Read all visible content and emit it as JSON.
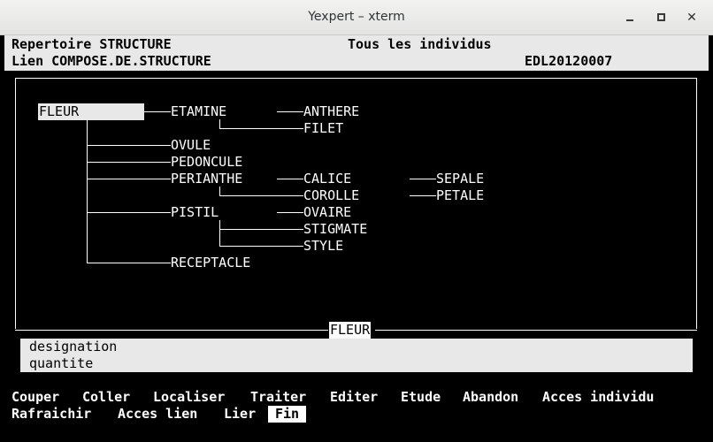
{
  "window": {
    "title": "Yexpert – xterm"
  },
  "header": {
    "repertoire": "Repertoire STRUCTURE",
    "scope": "Tous les individus",
    "lien": "Lien COMPOSE.DE.STRUCTURE",
    "code": "EDL20120007"
  },
  "tree": {
    "root": "FLEUR",
    "nodes": {
      "etamine": "ETAMINE",
      "anthere": "ANTHERE",
      "filet": "FILET",
      "ovule": "OVULE",
      "pedoncule": "PEDONCULE",
      "perianthe": "PERIANTHE",
      "calice": "CALICE",
      "sepale": "SEPALE",
      "corolle": "COROLLE",
      "petale": "PETALE",
      "pistil": "PISTIL",
      "ovaire": "OVAIRE",
      "stigmate": "STIGMATE",
      "style": "STYLE",
      "receptacle": "RECEPTACLE"
    }
  },
  "frame_label": "FLEUR",
  "attributes": [
    "designation",
    "quantite"
  ],
  "menu": {
    "row1": [
      "Couper",
      "Coller",
      "Localiser",
      "Traiter",
      "Editer",
      "Etude",
      "Abandon",
      "Acces individu"
    ],
    "row2": [
      "Rafraichir",
      "Acces lien",
      "Lier",
      "Fin"
    ]
  }
}
